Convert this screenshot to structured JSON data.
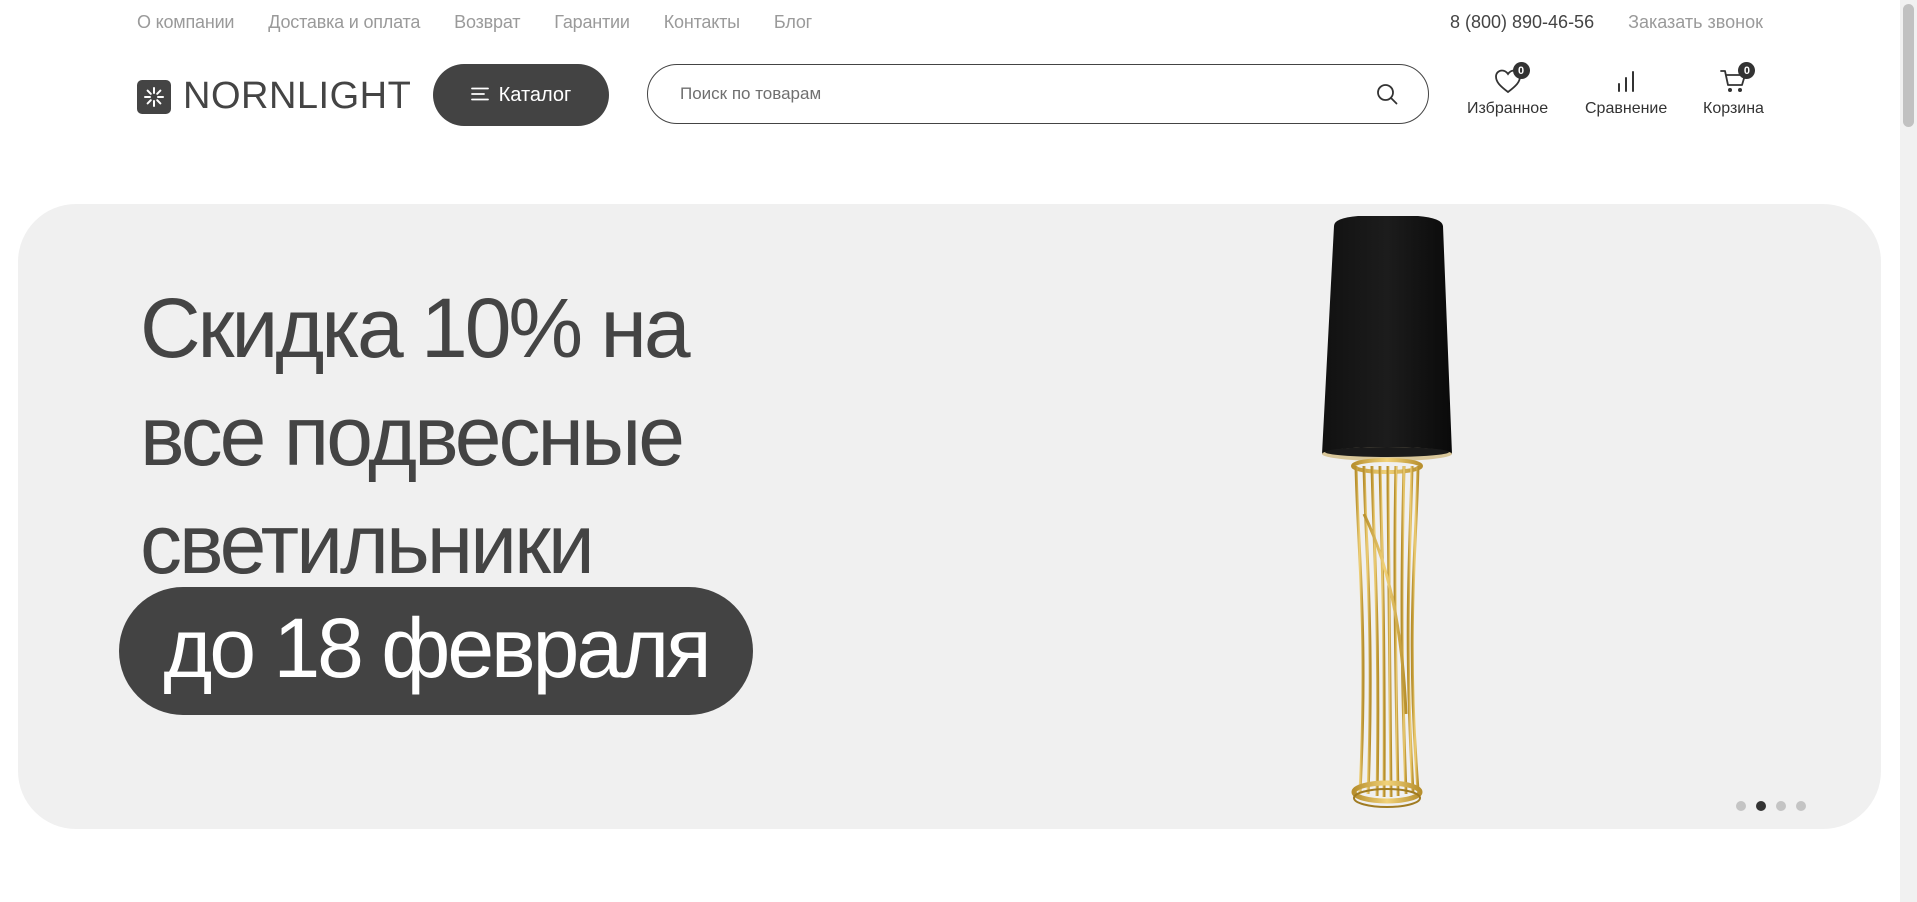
{
  "topnav": {
    "links": [
      "О компании",
      "Доставка и оплата",
      "Возврат",
      "Гарантии",
      "Контакты",
      "Блог"
    ],
    "phone": "8 (800) 890-46-56",
    "callback": "Заказать звонок"
  },
  "header": {
    "logo_text": "NORNLIGHT",
    "catalog_label": "Каталог",
    "search_placeholder": "Поиск по товарам",
    "favorites": {
      "label": "Избранное",
      "count": "0"
    },
    "compare": {
      "label": "Сравнение"
    },
    "cart": {
      "label": "Корзина",
      "count": "0"
    }
  },
  "banner": {
    "headline_lines": [
      "Скидка 10% на",
      "все подвесные",
      "светильники"
    ],
    "highlight": "до 18 февраля",
    "slides": 4,
    "active_slide": 2
  },
  "colors": {
    "primary_dark": "#434343",
    "banner_bg": "#f0f0f0",
    "muted_text": "#9a9a9a"
  }
}
